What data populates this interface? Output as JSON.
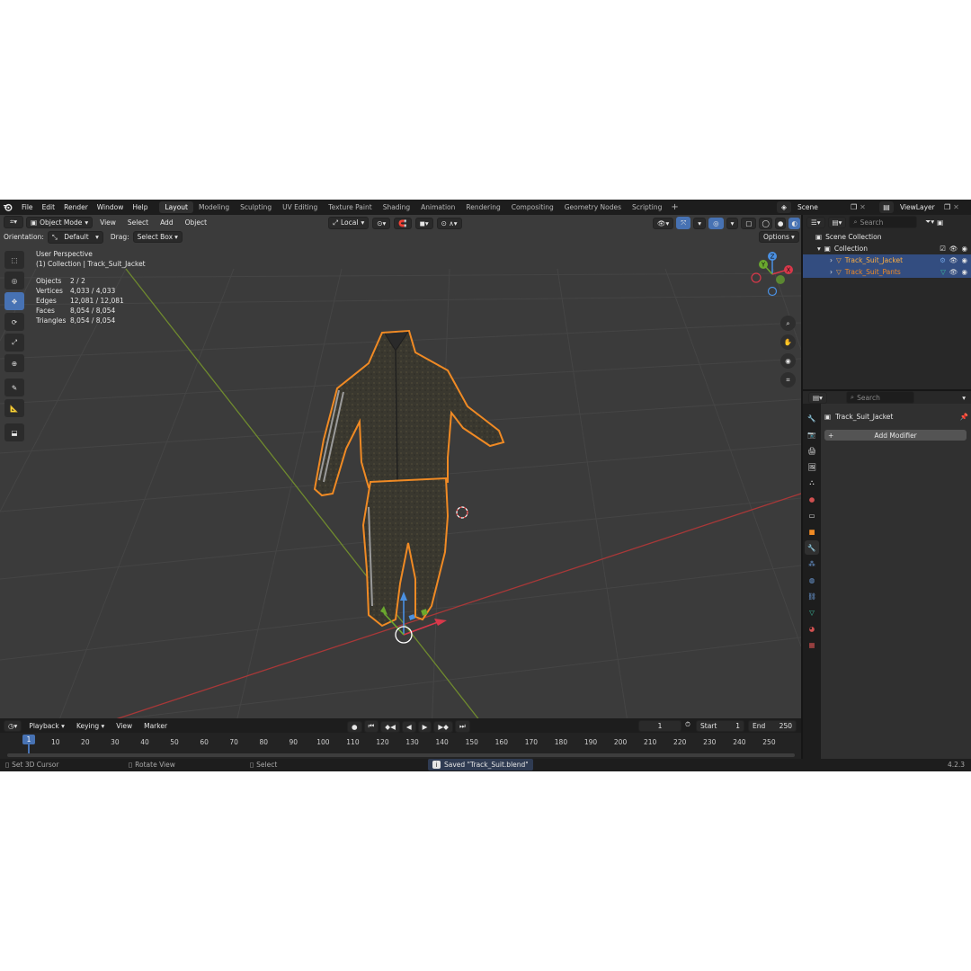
{
  "topbar": {
    "menus": [
      "File",
      "Edit",
      "Render",
      "Window",
      "Help"
    ],
    "workspaces": [
      "Layout",
      "Modeling",
      "Sculpting",
      "UV Editing",
      "Texture Paint",
      "Shading",
      "Animation",
      "Rendering",
      "Compositing",
      "Geometry Nodes",
      "Scripting"
    ],
    "active_workspace": "Layout",
    "add_tab": "+",
    "scene": "Scene",
    "view_layer": "ViewLayer"
  },
  "viewport": {
    "mode": "Object Mode",
    "menus": [
      "View",
      "Select",
      "Add",
      "Object"
    ],
    "transform_orientation": "Local",
    "orientation_label": "Orientation:",
    "orientation_value": "Default",
    "drag_label": "Drag:",
    "drag_value": "Select Box",
    "options": "Options",
    "overlay_title": "User Perspective",
    "overlay_subtitle": "(1) Collection | Track_Suit_Jacket",
    "stats": [
      {
        "key": "Objects",
        "value": "2 / 2"
      },
      {
        "key": "Vertices",
        "value": "4,033 / 4,033"
      },
      {
        "key": "Edges",
        "value": "12,081 / 12,081"
      },
      {
        "key": "Faces",
        "value": "8,054 / 8,054"
      },
      {
        "key": "Triangles",
        "value": "8,054 / 8,054"
      }
    ],
    "gizmo": {
      "x": "X",
      "y": "Y",
      "z": "Z"
    },
    "colors": {
      "background": "#3b3b3b",
      "x_axis": "#a83838",
      "y_axis": "#6f8a2e",
      "selection": "#f08a24",
      "active_tool": "#4772b3"
    }
  },
  "timeline": {
    "menus": [
      "Playback",
      "Keying",
      "View",
      "Marker"
    ],
    "current_frame": "1",
    "start_label": "Start",
    "start": "1",
    "end_label": "End",
    "end": "250",
    "ruler": [
      "10",
      "20",
      "30",
      "40",
      "50",
      "60",
      "70",
      "80",
      "90",
      "100",
      "110",
      "120",
      "130",
      "140",
      "150",
      "160",
      "170",
      "180",
      "190",
      "200",
      "210",
      "220",
      "230",
      "240",
      "250"
    ],
    "playhead": "1"
  },
  "statusbar": {
    "left": "Set 3D Cursor",
    "middle": "Rotate View",
    "right": "Select",
    "message": "Saved \"Track_Suit.blend\"",
    "version": "4.2.3"
  },
  "outliner": {
    "search_placeholder": "Search",
    "scene_collection": "Scene Collection",
    "collection": "Collection",
    "objects": [
      {
        "name": "Track_Suit_Jacket",
        "selected": true,
        "active": true
      },
      {
        "name": "Track_Suit_Pants",
        "selected": true,
        "active": false
      }
    ]
  },
  "properties": {
    "search_placeholder": "Search",
    "object_name": "Track_Suit_Jacket",
    "add_modifier": "Add Modifier"
  }
}
